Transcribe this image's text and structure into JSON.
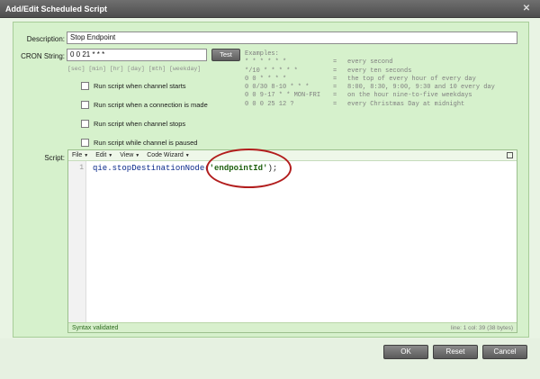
{
  "window": {
    "title": "Add/Edit Scheduled Script"
  },
  "form": {
    "description_label": "Description:",
    "description_value": "Stop Endpoint",
    "cron_label": "CRON String:",
    "cron_value": "0 0  21 * * *",
    "cron_hint": "[sec] [min] [hr] [day] [mth] [weekday]",
    "test_label": "Test",
    "checkboxes": [
      {
        "label": "Run script when channel starts",
        "checked": false
      },
      {
        "label": "Run script when a connection is made",
        "checked": false
      },
      {
        "label": "Run script when channel stops",
        "checked": false
      },
      {
        "label": "Run script while channel is paused",
        "checked": false
      }
    ],
    "script_label": "Script:"
  },
  "examples": {
    "title": "Examples:",
    "rows": [
      {
        "cron": "* * * * * *",
        "eq": "=",
        "desc": "every second"
      },
      {
        "cron": "*/10 * * * * *",
        "eq": "=",
        "desc": "every ten seconds"
      },
      {
        "cron": "0 0 * * * *",
        "eq": "=",
        "desc": "the top of every hour of every day"
      },
      {
        "cron": "0 0/30 8-10 * * *",
        "eq": "=",
        "desc": "8:00, 8:30, 9:00, 9:30 and 10 every day"
      },
      {
        "cron": "0 0 9-17 * * MON-FRI",
        "eq": "=",
        "desc": "on the hour nine-to-five weekdays"
      },
      {
        "cron": "0 0 0 25 12 ?",
        "eq": "=",
        "desc": "every Christmas Day at midnight"
      }
    ]
  },
  "editor": {
    "menu": [
      "File",
      "Edit",
      "View",
      "Code Wizard"
    ],
    "line_number": "1",
    "code_prefix": "qie.stopDestinationNode(",
    "code_string": "'endpointId'",
    "code_suffix": ");",
    "status_left": "Syntax validated",
    "status_right": "line: 1  col: 39  (38 bytes)"
  },
  "buttons": {
    "ok": "OK",
    "reset": "Reset",
    "cancel": "Cancel"
  },
  "colors": {
    "accent": "#b21d1d",
    "panel": "#d6f1cc",
    "title_bar": "#5a5a5a"
  }
}
